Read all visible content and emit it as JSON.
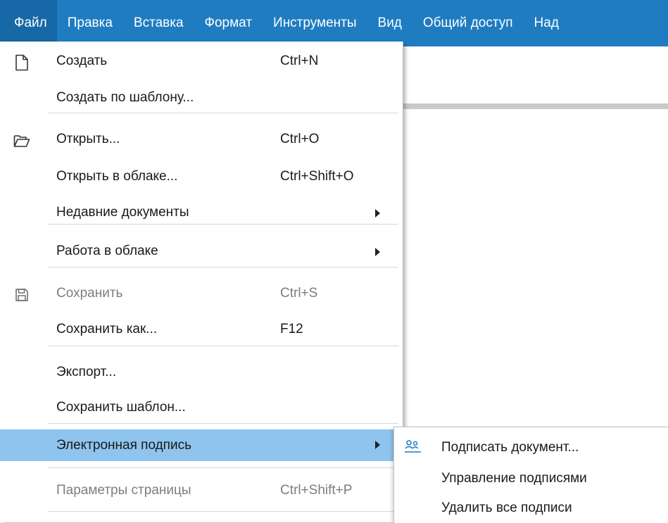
{
  "menubar": {
    "items": [
      "Файл",
      "Правка",
      "Вставка",
      "Формат",
      "Инструменты",
      "Вид",
      "Общий доступ",
      "Над"
    ]
  },
  "file_menu": {
    "new": {
      "label": "Создать",
      "shortcut": "Ctrl+N",
      "icon": "new-document-icon"
    },
    "new_from_template": {
      "label": "Создать по шаблону..."
    },
    "open": {
      "label": "Открыть...",
      "shortcut": "Ctrl+O",
      "icon": "folder-open-icon"
    },
    "open_cloud": {
      "label": "Открыть в облаке...",
      "shortcut": "Ctrl+Shift+O"
    },
    "recent": {
      "label": "Недавние документы"
    },
    "cloud_work": {
      "label": "Работа в облаке"
    },
    "save": {
      "label": "Сохранить",
      "shortcut": "Ctrl+S",
      "icon": "save-icon",
      "disabled": true
    },
    "save_as": {
      "label": "Сохранить как...",
      "shortcut": "F12"
    },
    "export": {
      "label": "Экспорт..."
    },
    "save_template": {
      "label": "Сохранить шаблон..."
    },
    "e_signature": {
      "label": "Электронная подпись",
      "highlighted": true
    },
    "page_settings": {
      "label": "Параметры страницы",
      "shortcut": "Ctrl+Shift+P",
      "disabled": true
    }
  },
  "signature_submenu": {
    "sign": {
      "label": "Подписать документ...",
      "icon": "signature-icon"
    },
    "manage": {
      "label": "Управление подписями"
    },
    "remove_all": {
      "label": "Удалить все подписи"
    }
  },
  "colors": {
    "menubar_bg": "#1f7cc1",
    "menubar_active": "#1668a6",
    "highlight": "#8ec4ed",
    "disabled_text": "#7d7d7d"
  }
}
